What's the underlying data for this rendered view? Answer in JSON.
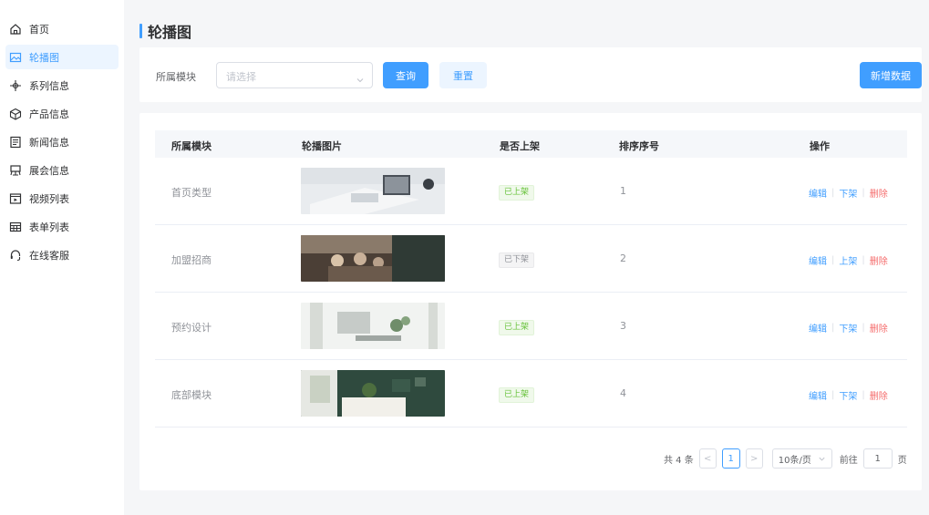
{
  "sidebar": {
    "items": [
      {
        "label": "首页",
        "icon": "home-icon"
      },
      {
        "label": "轮播图",
        "icon": "image-icon"
      },
      {
        "label": "系列信息",
        "icon": "series-icon"
      },
      {
        "label": "产品信息",
        "icon": "box-icon"
      },
      {
        "label": "新闻信息",
        "icon": "news-icon"
      },
      {
        "label": "展会信息",
        "icon": "exhibition-icon"
      },
      {
        "label": "视频列表",
        "icon": "video-icon"
      },
      {
        "label": "表单列表",
        "icon": "table-icon"
      },
      {
        "label": "在线客服",
        "icon": "headset-icon"
      }
    ],
    "active_index": 1
  },
  "page": {
    "title": "轮播图"
  },
  "filter": {
    "module_label": "所属模块",
    "select_placeholder": "请选择",
    "query_label": "查询",
    "reset_label": "重置",
    "add_label": "新增数据"
  },
  "table": {
    "headers": [
      "所属模块",
      "轮播图片",
      "是否上架",
      "排序序号",
      "操作"
    ],
    "rows": [
      {
        "module": "首页类型",
        "status": "已上架",
        "sort": "1",
        "edit": "编辑",
        "toggle": "下架",
        "delete": "删除"
      },
      {
        "module": "加盟招商",
        "status": "已下架",
        "sort": "2",
        "edit": "编辑",
        "toggle": "上架",
        "delete": "删除"
      },
      {
        "module": "预约设计",
        "status": "已上架",
        "sort": "3",
        "edit": "编辑",
        "toggle": "下架",
        "delete": "删除"
      },
      {
        "module": "底部模块",
        "status": "已上架",
        "sort": "4",
        "edit": "编辑",
        "toggle": "下架",
        "delete": "删除"
      }
    ]
  },
  "pagination": {
    "total_text": "共 4 条",
    "prev": "<",
    "current_page": "1",
    "next": ">",
    "page_size": "10条/页",
    "goto_label": "前往",
    "goto_value": "1",
    "page_suffix": "页"
  },
  "colors": {
    "primary": "#409eff",
    "success": "#67c23a",
    "danger": "#f56c6c"
  }
}
